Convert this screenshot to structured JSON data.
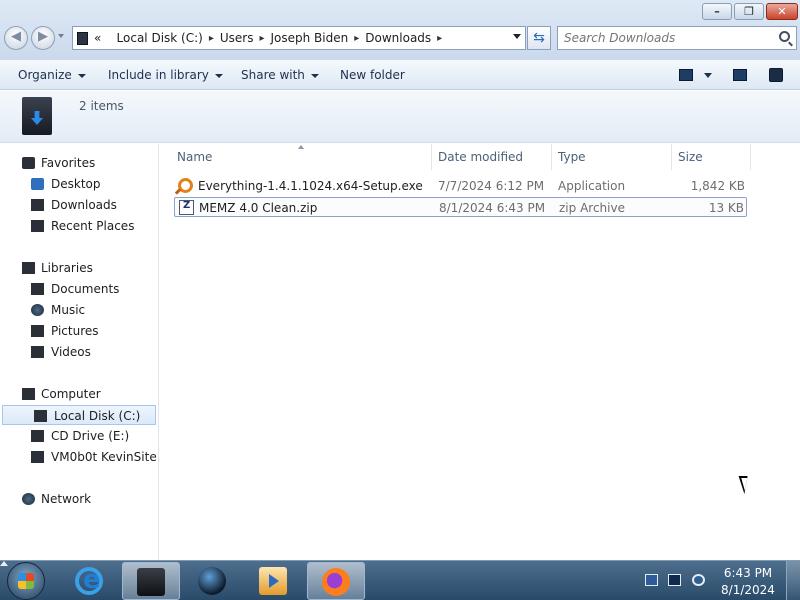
{
  "window": {
    "minimize_glyph": "–",
    "maximize_glyph": "❐",
    "close_glyph": "✕"
  },
  "nav": {
    "back_glyph": "◀",
    "forward_glyph": "▶"
  },
  "address": {
    "prefix": "«",
    "crumbs": [
      "Local Disk (C:)",
      "Users",
      "Joseph Biden",
      "Downloads"
    ],
    "sep": "▸"
  },
  "search": {
    "placeholder": "Search Downloads"
  },
  "toolbar": {
    "organize": "Organize",
    "include_in_library": "Include in library",
    "share_with": "Share with",
    "new_folder": "New folder"
  },
  "details": {
    "count": "2 items"
  },
  "sidebar": {
    "favorites": "Favorites",
    "desktop": "Desktop",
    "downloads": "Downloads",
    "recent_places": "Recent Places",
    "libraries": "Libraries",
    "documents": "Documents",
    "music": "Music",
    "pictures": "Pictures",
    "videos": "Videos",
    "computer": "Computer",
    "local_disk": "Local Disk (C:)",
    "cd_drive": "CD Drive (E:)",
    "vm_site": "VM0b0t KevinSite",
    "network": "Network"
  },
  "columns": {
    "name": "Name",
    "date_modified": "Date modified",
    "type": "Type",
    "size": "Size"
  },
  "files": [
    {
      "name": "Everything-1.4.1.1024.x64-Setup.exe",
      "date": "7/7/2024 6:12 PM",
      "type": "Application",
      "size": "1,842 KB",
      "icon": "everything-search-icon"
    },
    {
      "name": "MEMZ 4.0 Clean.zip",
      "date": "8/1/2024 6:43 PM",
      "type": "zip Archive",
      "size": "13 KB",
      "icon": "zip-archive-icon"
    }
  ],
  "taskbar": {
    "time": "6:43 PM",
    "date": "8/1/2024"
  },
  "colors": {
    "accent": "#2f6fc0",
    "taskbar": "#3a5a7a",
    "selection_border": "#8aa4c4"
  }
}
